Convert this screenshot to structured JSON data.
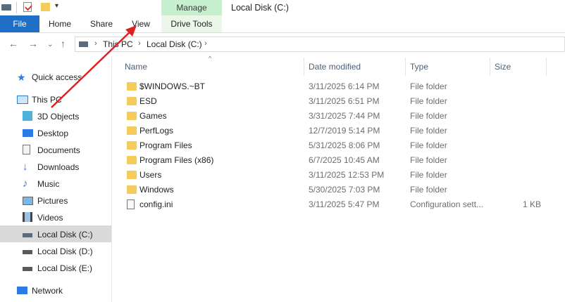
{
  "window": {
    "title": "Local Disk (C:)"
  },
  "ribbon": {
    "context_group": "Manage",
    "tabs": [
      "File",
      "Home",
      "Share",
      "View",
      "Drive Tools"
    ]
  },
  "address": {
    "crumbs": [
      "This PC",
      "Local Disk (C:)"
    ]
  },
  "sidebar": {
    "items": [
      {
        "label": "Quick access",
        "icon": "star-icon"
      },
      {
        "label": "This PC",
        "icon": "computer-icon"
      },
      {
        "label": "3D Objects",
        "icon": "cube-icon"
      },
      {
        "label": "Desktop",
        "icon": "desktop-icon"
      },
      {
        "label": "Documents",
        "icon": "document-icon"
      },
      {
        "label": "Downloads",
        "icon": "download-icon"
      },
      {
        "label": "Music",
        "icon": "music-icon"
      },
      {
        "label": "Pictures",
        "icon": "picture-icon"
      },
      {
        "label": "Videos",
        "icon": "video-icon"
      },
      {
        "label": "Local Disk (C:)",
        "icon": "drive-icon"
      },
      {
        "label": "Local Disk (D:)",
        "icon": "drive-icon"
      },
      {
        "label": "Local Disk (E:)",
        "icon": "drive-icon"
      },
      {
        "label": "Network",
        "icon": "network-icon"
      }
    ]
  },
  "columns": {
    "name": "Name",
    "date": "Date modified",
    "type": "Type",
    "size": "Size"
  },
  "files": [
    {
      "name": "$WINDOWS.~BT",
      "date": "3/11/2025 6:14 PM",
      "type": "File folder",
      "size": ""
    },
    {
      "name": "ESD",
      "date": "3/11/2025 6:51 PM",
      "type": "File folder",
      "size": ""
    },
    {
      "name": "Games",
      "date": "3/31/2025 7:44 PM",
      "type": "File folder",
      "size": ""
    },
    {
      "name": "PerfLogs",
      "date": "12/7/2019 5:14 PM",
      "type": "File folder",
      "size": ""
    },
    {
      "name": "Program Files",
      "date": "5/31/2025 8:06 PM",
      "type": "File folder",
      "size": ""
    },
    {
      "name": "Program Files (x86)",
      "date": "6/7/2025 10:45 AM",
      "type": "File folder",
      "size": ""
    },
    {
      "name": "Users",
      "date": "3/11/2025 12:53 PM",
      "type": "File folder",
      "size": ""
    },
    {
      "name": "Windows",
      "date": "5/30/2025 7:03 PM",
      "type": "File folder",
      "size": ""
    },
    {
      "name": "config.ini",
      "date": "3/11/2025 5:47 PM",
      "type": "Configuration sett...",
      "size": "1 KB"
    }
  ],
  "colors": {
    "accent": "#1e6fc5",
    "context_tab": "#c6efce",
    "annotation_arrow": "#e02020"
  }
}
